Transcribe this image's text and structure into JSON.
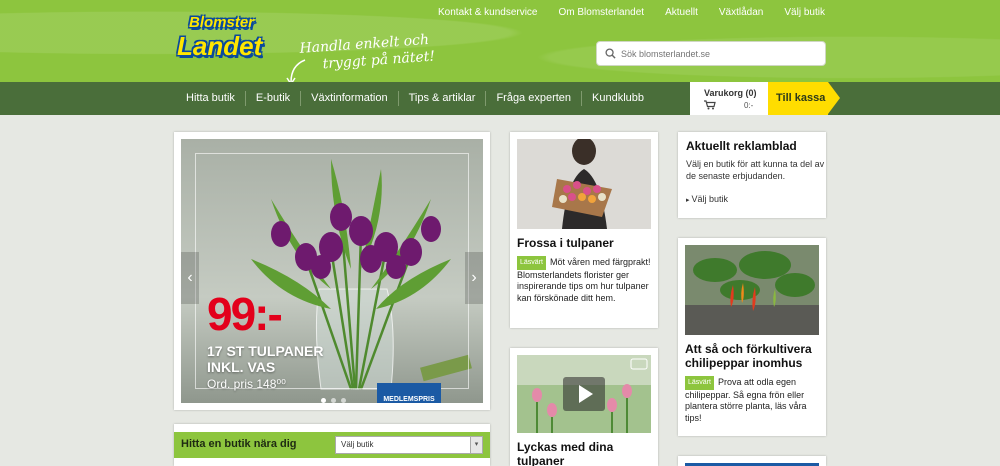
{
  "top_links": [
    "Kontakt & kundservice",
    "Om Blomsterlandet",
    "Aktuellt",
    "Växtlådan",
    "Välj butik"
  ],
  "logo": {
    "line1": "Blomster",
    "line2": "Landet"
  },
  "slogan": {
    "line1": "Handla enkelt och",
    "line2": "tryggt på nätet!"
  },
  "search": {
    "placeholder": "Sök blomsterlandet.se"
  },
  "nav": [
    "Hitta butik",
    "E-butik",
    "Växtinformation",
    "Tips & artiklar",
    "Fråga experten",
    "Kundklubb"
  ],
  "cart": {
    "label": "Varukorg (0)",
    "amount": "0:-"
  },
  "checkout": {
    "label": "Till kassa"
  },
  "hero": {
    "price": "99:-",
    "title_line1": "17 ST TULPANER",
    "title_line2": "INKL. VAS",
    "original_price": "Ord. pris 148⁰⁰",
    "member_label": "MEDLEMSPRIS",
    "prev": "‹",
    "next": "›",
    "slides": 3,
    "active_slide": 1
  },
  "find_store": {
    "title": "Hitta en butik nära dig",
    "select_value": "Välj butik"
  },
  "articles": [
    {
      "title": "Frossa i tulpaner",
      "badge": "Läsvärt",
      "text": "Möt våren med färgprakt! Blomsterlandets florister ger inspirerande tips om hur tulpaner kan förskönade ditt hem."
    },
    {
      "title_line1": "Lyckas med dina",
      "title_line2": "tulpaner"
    },
    {
      "title_line1": "Att så och förkultivera",
      "title_line2": "chilipeppar inomhus",
      "badge": "Läsvärt",
      "text": "Prova att odla egen chilipeppar. Så egna frön eller plantera större planta, läs våra tips!"
    }
  ],
  "reklamblad": {
    "title": "Aktuellt reklamblad",
    "text": "Välj en butik för att kunna ta del av de senaste erbjudanden.",
    "link": "Välj butik"
  },
  "colors": {
    "header_green": "#8dc53e",
    "nav_green": "#4a6e3a",
    "checkout_yellow": "#ffdd00",
    "price_red": "#e3001b"
  }
}
